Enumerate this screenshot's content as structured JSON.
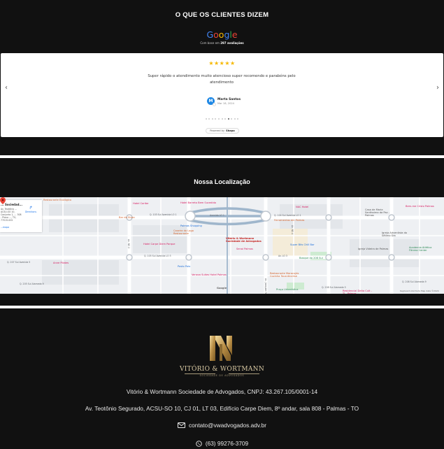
{
  "testimonials": {
    "title": "O QUE OS CLIENTES DIZEM",
    "google_logo": [
      "G",
      "o",
      "o",
      "g",
      "l",
      "e"
    ],
    "google_colors": [
      "#4285F4",
      "#EA4335",
      "#FBBC05",
      "#4285F4",
      "#34A853",
      "#EA4335"
    ],
    "based_prefix": "Com base em",
    "based_count": "297 avaliações",
    "stars": "★★★★★",
    "star_color": "#f6b800",
    "rating": 5,
    "review_text": "Super rápido o atendimento muito atencioso super recomendo e parabéns pelo atendimento",
    "author_initial": "M",
    "author_name": "Marta Santos",
    "author_date": "Mar 18, 2024",
    "prev_arrow": "‹",
    "next_arrow": "›",
    "pager_count": 11,
    "pager_active": 7,
    "powered_prefix": "Powered by",
    "powered_brand": "Shapo"
  },
  "location": {
    "title": "Nossa Localização",
    "place_name": "Vitório & Wortmann Sociedade de Advogados",
    "place_card_name": "... Sociedad...",
    "place_card_address": "Av. Teotônio ... ACSU-SO 10, Conjunto 1, ... 308 - Plano ..., TO, 77015-002",
    "directions_label": "Directions",
    "view_larger": "...mapa",
    "labels": [
      {
        "text": "Restaurante Ecológico",
        "color": "#d5622a"
      },
      {
        "text": "Hotel Caribe",
        "color": "#d81b60"
      },
      {
        "text": "Hotel Barreto Bem Sucedido",
        "color": "#d81b60"
      },
      {
        "text": "Bar do Sivan",
        "color": "#d5622a"
      },
      {
        "text": "Palmas Shopping",
        "color": "#1e6fd9"
      },
      {
        "text": "Caseira do Lago Restaurante",
        "color": "#d5622a"
      },
      {
        "text": "Hotel Carpe Diem Parque",
        "color": "#d81b60"
      },
      {
        "text": "Vitório & Wortmann Sociedade de Advogados",
        "color": "#c5221f"
      },
      {
        "text": "Senai Palmas",
        "color": "#d81b60"
      },
      {
        "text": "Ferramentas em Palmas",
        "color": "#d5622a"
      },
      {
        "text": "NAC Hotel",
        "color": "#d81b60"
      },
      {
        "text": "Casa de Maria Santíssima da Paz - Palmas",
        "color": "#555555"
      },
      {
        "text": "Bem-me Cristo Palmas",
        "color": "#d81b60"
      },
      {
        "text": "Igreja Adventista do Sétimo Dia",
        "color": "#555555"
      },
      {
        "text": "Super Bits Chill Bar",
        "color": "#1e6fd9"
      },
      {
        "text": "Bosque do 208 Sul",
        "color": "#2e8b57"
      },
      {
        "text": "Igreja Videira de Palmas",
        "color": "#555555"
      },
      {
        "text": "Academia Atlética Fitness Center",
        "color": "#2e8b57"
      },
      {
        "text": "Anne Pilates",
        "color": "#d81b60"
      },
      {
        "text": "Posto Polo",
        "color": "#1e6fd9"
      },
      {
        "text": "Veneza Suites Hotel Palmas",
        "color": "#d81b60"
      },
      {
        "text": "Restaurante Maracujás Cozinha Tocantinense",
        "color": "#d5622a"
      },
      {
        "text": "Praça Urbanística",
        "color": "#2e8b57"
      },
      {
        "text": "Residencial Deita Cult - TI - Palmas",
        "color": "#d81b60"
      }
    ],
    "streets": [
      "Q. 103 Sul Avenida LO 1",
      "Q. 104 Sul Avenida LO 1",
      "Avenida LO 1",
      "Q. 105 Sul Avenida LO 3",
      "Av. LO 3",
      "Q. 207 Sul Avenida 5",
      "Q. 205 Sul Alameda 9",
      "Q. 208 Sul Alameda 9",
      "Q. 208 Sul Alameda 5",
      "Av. NS 2",
      "Av. NS 4",
      "Av. Joaquim Teotônio Segurado"
    ],
    "attribution": "Keyboard shortcuts  Map data ©2024",
    "google_mark": "Google"
  },
  "footer": {
    "brand": "VITÓRIO & WORTMANN",
    "brand_sub": "SOCIEDADE DE ADVOGADOS",
    "company": "Vitório & Wortmann Sociedade de Advogados, CNPJ: 43.267.105/0001-14",
    "address": "Av. Teotônio Segurado, ACSU-SO 10, CJ 01, LT 03, Edifício Carpe Diem, 8º andar, sala 808 - Palmas - TO",
    "email": "contato@vwadvogados.adv.br",
    "phone": "(63) 99276-3709",
    "gold": "#c9a96a"
  }
}
